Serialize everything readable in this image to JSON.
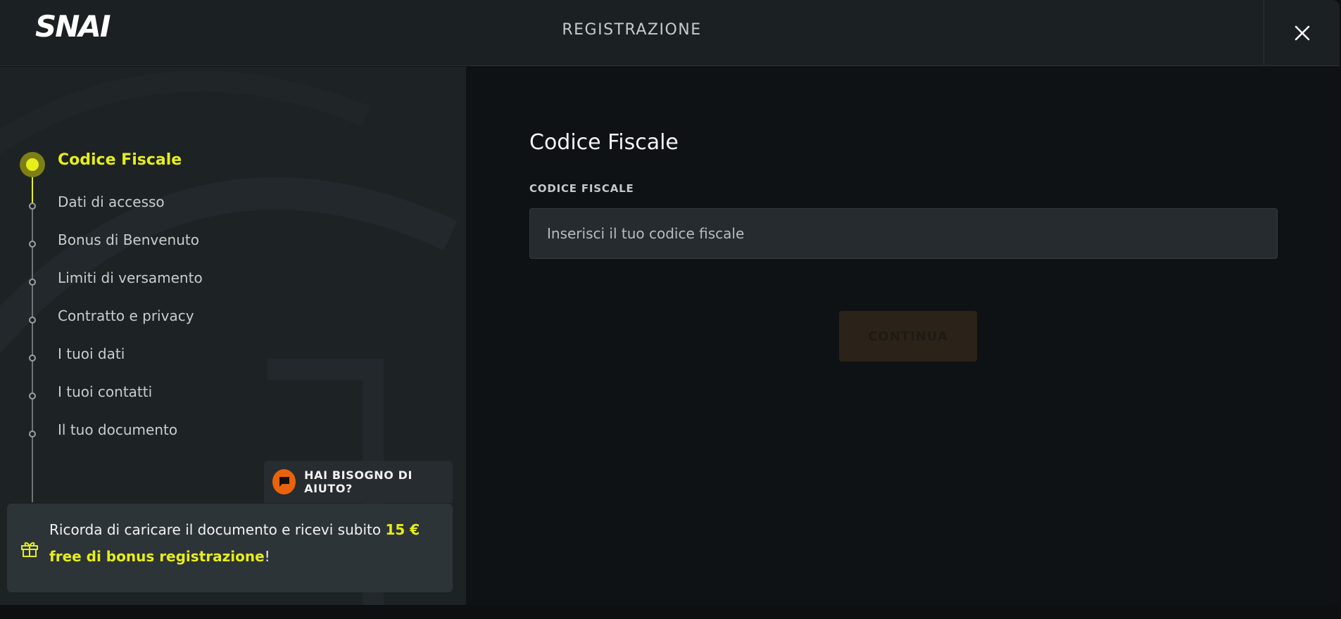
{
  "header": {
    "title": "REGISTRAZIONE",
    "logo_text": "SNAI"
  },
  "sidebar": {
    "steps": [
      {
        "label": "Codice Fiscale",
        "active": true
      },
      {
        "label": "Dati di accesso",
        "active": false
      },
      {
        "label": "Bonus di Benvenuto",
        "active": false
      },
      {
        "label": "Limiti di versamento",
        "active": false
      },
      {
        "label": "Contratto e privacy",
        "active": false
      },
      {
        "label": "I tuoi dati",
        "active": false
      },
      {
        "label": "I tuoi contatti",
        "active": false
      },
      {
        "label": "Il tuo documento",
        "active": false
      }
    ],
    "help_label": "HAI BISOGNO DI AIUTO?",
    "bonus": {
      "text_before": "Ricorda di caricare il documento e ricevi subito ",
      "highlight": "15 € free di bonus registrazione",
      "text_after": "!"
    }
  },
  "main": {
    "title": "Codice Fiscale",
    "field_label": "CODICE FISCALE",
    "field_placeholder": "Inserisci il tuo codice fiscale",
    "field_value": "",
    "continue_label": "CONTINUA"
  },
  "colors": {
    "accent_yellow": "#e6ee19",
    "help_orange": "#e8630c",
    "panel_dark": "#1d2225",
    "main_dark": "#0f1214"
  }
}
